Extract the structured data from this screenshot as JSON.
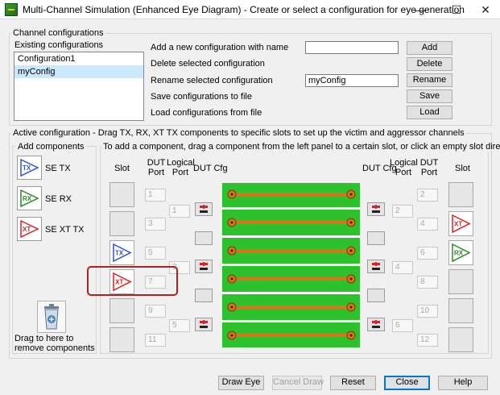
{
  "window": {
    "title": "Multi-Channel Simulation (Enhanced Eye Diagram) - Create or select a configuration for eye generation",
    "minimize_glyph": "—",
    "maximize_glyph": "☐",
    "close_glyph": "✕"
  },
  "channel_configurations": {
    "legend": "Channel configurations",
    "existing_label": "Existing configurations",
    "items": [
      "Configuration1",
      "myConfig"
    ],
    "selected_index": 1,
    "add_label": "Add a new configuration with name",
    "add_value": "",
    "add_button": "Add",
    "delete_label": "Delete selected configuration",
    "delete_button": "Delete",
    "rename_label": "Rename selected configuration",
    "rename_value": "myConfig",
    "rename_button": "Rename",
    "save_label": "Save configurations to file",
    "save_button": "Save",
    "load_label": "Load configurations from file",
    "load_button": "Load"
  },
  "active_configuration": {
    "legend": "Active configuration - Drag TX, RX, XT TX components to specific slots to set up the victim and aggressor channels",
    "add_components_legend": "Add components",
    "components": [
      {
        "icon_text": "TX",
        "label": "SE TX",
        "icon": "tx-driver-icon",
        "color": "#3050e0"
      },
      {
        "icon_text": "RX",
        "label": "SE RX",
        "icon": "rx-receiver-icon",
        "color": "#2a8a2a"
      },
      {
        "icon_text": "XT",
        "label": "SE XT TX",
        "icon": "xt-aggressor-icon",
        "color": "#e02020"
      }
    ],
    "trash_text": "Drag to here to remove components",
    "slots_legend": "To add a component, drag a component from the left panel to a certain slot, or click an empty slot directly",
    "headers": {
      "left_slot": "Slot",
      "left_dut_port": "DUT Port",
      "left_logical_port": "Logical Port",
      "left_dut_cfg": "DUT Cfg",
      "right_dut_cfg": "DUT Cfg",
      "right_logical_port": "Logical Port",
      "right_dut_port": "DUT Port",
      "right_slot": "Slot"
    },
    "left_dut_ports": [
      "1",
      "3",
      "5",
      "7",
      "9",
      "11"
    ],
    "right_dut_ports": [
      "2",
      "4",
      "6",
      "8",
      "10",
      "12"
    ],
    "left_logical_ports": [
      "1",
      "3",
      "5"
    ],
    "right_logical_ports": [
      "2",
      "4",
      "6"
    ],
    "left_slots": [
      "",
      "",
      "TX",
      "XT",
      "",
      ""
    ],
    "right_slots": [
      "",
      "XT",
      "RX",
      "",
      "",
      ""
    ]
  },
  "footer": {
    "draw_eye": "Draw Eye",
    "cancel_draw": "Cancel Draw",
    "reset": "Reset",
    "close": "Close",
    "help": "Help"
  },
  "colors": {
    "board_green": "#2dc22d",
    "trace_orange": "#d9741a",
    "highlight_red": "#b02020",
    "tx_blue": "#3050e0",
    "rx_green": "#2a8a2a",
    "xt_red": "#e02020"
  }
}
